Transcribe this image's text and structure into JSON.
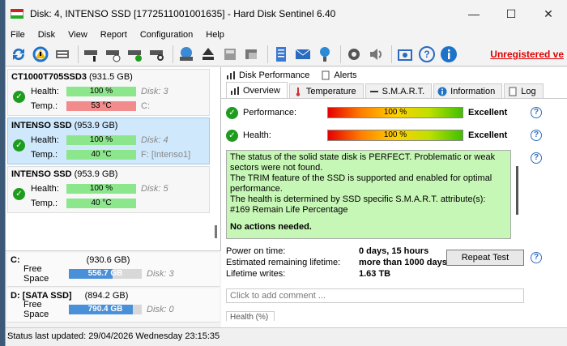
{
  "window": {
    "title": "Disk: 4, INTENSO SSD [1772511001001635]  -  Hard Disk Sentinel 6.40"
  },
  "menu": [
    "File",
    "Disk",
    "View",
    "Report",
    "Configuration",
    "Help"
  ],
  "toolbar": {
    "unregistered": "Unregistered ve"
  },
  "disks": [
    {
      "name": "CT1000T705SSD3",
      "size": "(931.5 GB)",
      "health": "100 %",
      "temp": "53 °C",
      "health_extra": "Disk: 3",
      "temp_extra": "C:"
    },
    {
      "name": "INTENSO SSD",
      "size": "(953.9 GB)",
      "health": "100 %",
      "temp": "40 °C",
      "health_extra": "Disk: 4",
      "temp_extra": "F: [Intenso1]"
    },
    {
      "name": "INTENSO SSD",
      "size": "(953.9 GB)",
      "health": "100 %",
      "temp": "40 °C",
      "health_extra": "Disk: 5",
      "temp_extra": ""
    }
  ],
  "labels": {
    "health": "Health:",
    "temp": "Temp.:",
    "free_space": "Free Space"
  },
  "volumes": [
    {
      "name": "C:",
      "size": "(930.6 GB)",
      "free": "556.7 GB",
      "disk": "Disk: 3",
      "used_fraction": 0.4
    },
    {
      "name": "D: [SATA SSD]",
      "size": "(894.2 GB)",
      "free": "790.4 GB",
      "disk": "Disk: 0",
      "used_fraction": 0.12
    }
  ],
  "tabs_top": [
    "Disk Performance",
    "Alerts"
  ],
  "tabs": [
    "Overview",
    "Temperature",
    "S.M.A.R.T.",
    "Information",
    "Log"
  ],
  "overview": {
    "performance_label": "Performance:",
    "performance_value": "100 %",
    "performance_status": "Excellent",
    "health_label": "Health:",
    "health_value": "100 %",
    "health_status": "Excellent",
    "message_lines": [
      "The status of the solid state disk is PERFECT. Problematic or weak sectors were not found.",
      "The TRIM feature of the SSD is supported and enabled for optimal performance.",
      "The health is determined by SSD specific S.M.A.R.T. attribute(s):  #169 Remain Life Percentage"
    ],
    "message_action": "No actions needed.",
    "power_on_label": "Power on time:",
    "power_on_value": "0 days, 15 hours",
    "lifetime_label": "Estimated remaining lifetime:",
    "lifetime_value": "more than 1000 days",
    "writes_label": "Lifetime writes:",
    "writes_value": "1.63 TB",
    "repeat_button": "Repeat Test",
    "comment_placeholder": "Click to add comment ...",
    "health_tab": "Health (%)"
  },
  "status_bar": "Status last updated: 29/04/2026 Wednesday 23:15:35",
  "colors": {
    "health_bar": "#8ce68c",
    "temp_hot": "#f28b8b",
    "message_bg": "#c7f7b6",
    "unregistered": "#e00000"
  }
}
